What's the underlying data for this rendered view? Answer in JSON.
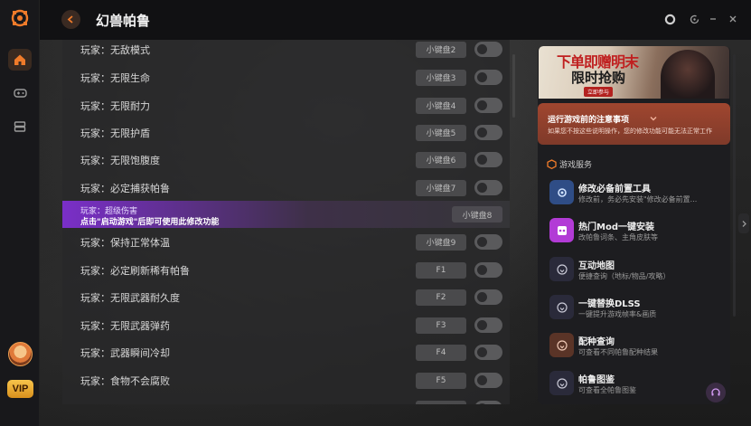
{
  "app": {
    "game_title": "幻兽帕鲁"
  },
  "rail": {
    "icons": [
      "logo-icon",
      "home-icon",
      "gamepad-icon",
      "box-icon"
    ],
    "vip_label": "VIP"
  },
  "cheats": [
    {
      "name": "玩家：无敌模式",
      "key": "小键盘2"
    },
    {
      "name": "玩家：无限生命",
      "key": "小键盘3"
    },
    {
      "name": "玩家：无限耐力",
      "key": "小键盘4"
    },
    {
      "name": "玩家：无限护盾",
      "key": "小键盘5"
    },
    {
      "name": "玩家：无限饱腹度",
      "key": "小键盘6"
    },
    {
      "name": "玩家：必定捕获帕鲁",
      "key": "小键盘7"
    },
    {
      "name": "玩家：超级伤害",
      "key": "小键盘8",
      "warning": "点击\"启动游戏\"后即可使用此修改功能"
    },
    {
      "name": "玩家：保持正常体温",
      "key": "小键盘9"
    },
    {
      "name": "玩家：必定刷新稀有帕鲁",
      "key": "F1"
    },
    {
      "name": "玩家：无限武器耐久度",
      "key": "F2"
    },
    {
      "name": "玩家：无限武器弹药",
      "key": "F3"
    },
    {
      "name": "玩家：武器瞬间冷却",
      "key": "F4"
    },
    {
      "name": "玩家：食物不会腐败",
      "key": "F5"
    }
  ],
  "banner": {
    "line1": "下单即赠明末",
    "line2": "限时抢购",
    "tag": "立即参与"
  },
  "notice": {
    "title": "运行游戏前的注意事项",
    "desc": "如果您不按这些说明操作，您的修改功能可能无法正常工作"
  },
  "services": {
    "heading": "游戏服务",
    "items": [
      {
        "title": "修改必备前置工具",
        "desc": "修改前，务必先安装\"修改必备前置...",
        "color": "#2f4d86",
        "icon": "tool-icon"
      },
      {
        "title": "热门Mod一键安装",
        "desc": "改帕鲁词条、主角皮肤等",
        "color": "#b23bd6",
        "icon": "mod-icon"
      },
      {
        "title": "互动地图",
        "desc": "便捷查询（地标/物品/攻略）",
        "color": "#2a2a3a",
        "icon": "map-icon"
      },
      {
        "title": "一键替换DLSS",
        "desc": "一键提升游戏帧率&画质",
        "color": "#2a2a3a",
        "icon": "dlss-icon"
      },
      {
        "title": "配种查询",
        "desc": "可查看不同帕鲁配种结果",
        "color": "#5a3427",
        "icon": "breeding-icon"
      },
      {
        "title": "帕鲁图鉴",
        "desc": "可查看全帕鲁图鉴",
        "color": "#2a2a3a",
        "icon": "book-icon"
      }
    ]
  }
}
